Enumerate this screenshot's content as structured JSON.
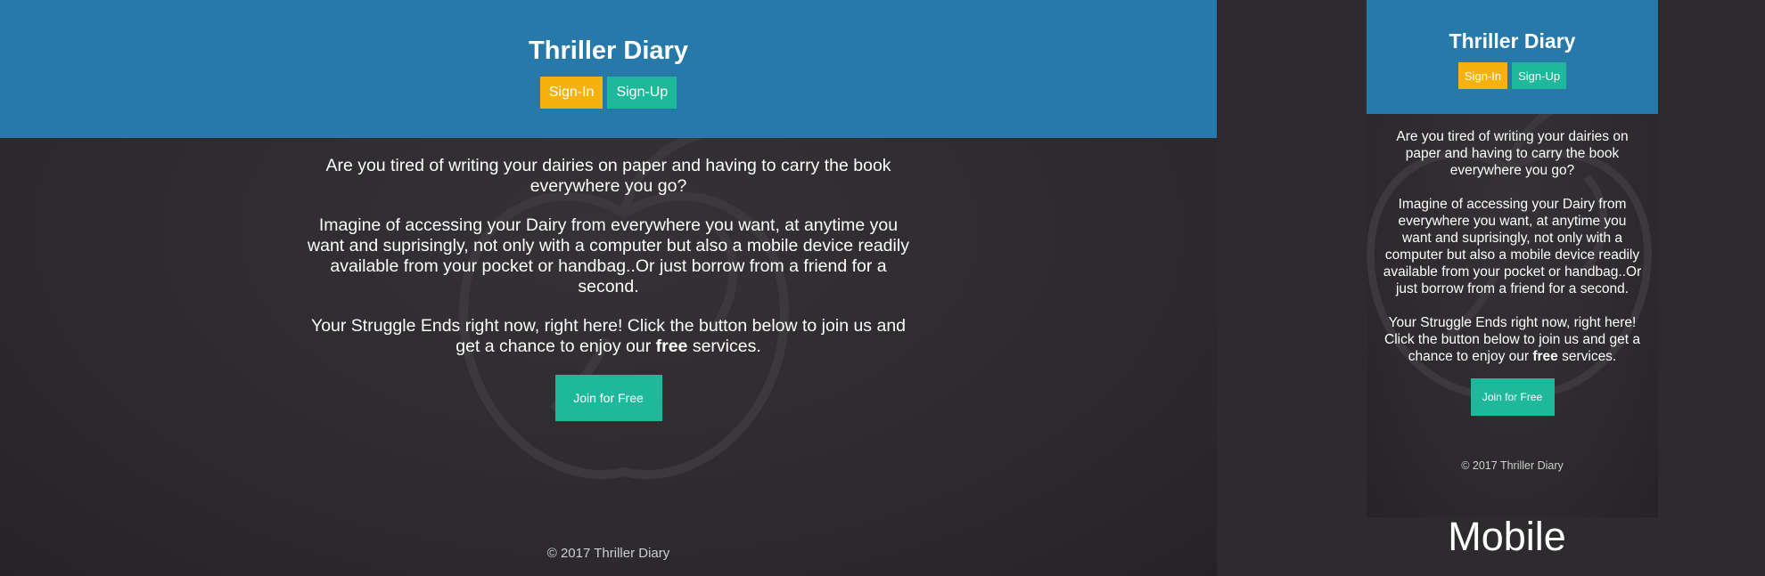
{
  "desktop": {
    "app_title": "Thriller Diary",
    "signin_label": "Sign-In",
    "signup_label": "Sign-Up",
    "paragraph_1": "Are you tired of writing your dairies on paper and having to carry the book everywhere you go?",
    "paragraph_2": "Imagine of accessing your Dairy from everywhere you want, at anytime you want and suprisingly, not only with a computer but also a mobile device readily available from your pocket or handbag..Or just borrow from a friend for a second.",
    "paragraph_3_before": "Your Struggle Ends right now, right here! Click the button below to join us and get a chance to enjoy our ",
    "paragraph_3_bold": "free",
    "paragraph_3_after": " services.",
    "join_label": "Join for Free",
    "footer": "© 2017 Thriller Diary"
  },
  "mobile": {
    "app_title": "Thriller Diary",
    "signin_label": "Sign-In",
    "signup_label": "Sign-Up",
    "paragraph_1": "Are you tired of writing your dairies on paper and having to carry the book everywhere you go?",
    "paragraph_2": "Imagine of accessing your Dairy from everywhere you want, at anytime you want and suprisingly, not only with a computer but also a mobile device readily available from your pocket or handbag..Or just borrow from a friend for a second.",
    "paragraph_3_before": "Your Struggle Ends right now, right here! Click the button below to join us and get a chance to enjoy our ",
    "paragraph_3_bold": "free",
    "paragraph_3_after": " services.",
    "join_label": "Join for Free",
    "footer": "© 2017 Thriller Diary"
  },
  "caption": "Mobile",
  "colors": {
    "header_blue": "#2779aa",
    "signin_yellow": "#f5b10e",
    "signup_teal": "#1eb99a",
    "background_dark": "#2e2b2f"
  },
  "icons": {
    "watermark": "apple-outline-watermark"
  }
}
